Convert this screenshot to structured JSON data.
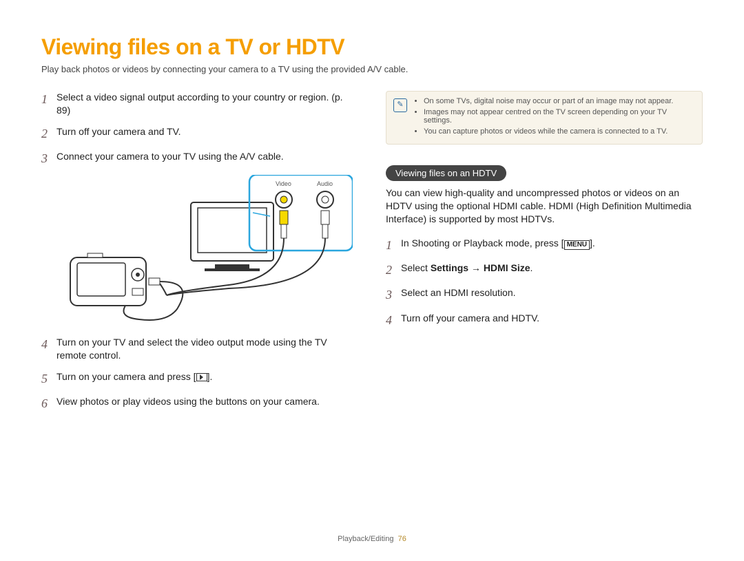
{
  "title": "Viewing files on a TV or HDTV",
  "subtitle": "Play back photos or videos by connecting your camera to a TV using the provided A/V cable.",
  "left_steps": [
    "Select a video signal output according to your country or region. (p. 89)",
    "Turn off your camera and TV.",
    "Connect your camera to your TV using the A/V cable.",
    "Turn on your TV and select the video output mode using the TV remote control.",
    "Turn on your camera and press [",
    "View photos or play videos using the buttons on your camera."
  ],
  "step5_suffix": "].",
  "diagram_labels": {
    "video": "Video",
    "audio": "Audio"
  },
  "notes": [
    "On some TVs, digital noise may occur or part of an image may not appear.",
    "Images may not appear centred on the TV screen depending on your TV settings.",
    "You can capture photos or videos while the camera is connected to a TV."
  ],
  "note_icon": "✎",
  "section2_title": "Viewing files on an HDTV",
  "section2_body": "You can view high-quality and uncompressed photos or videos on an HDTV using the optional HDMI cable. HDMI (High Definition Multimedia Interface) is supported by most HDTVs.",
  "right_steps": {
    "s1_a": "In Shooting or Playback mode, press [",
    "s1_menu": "MENU",
    "s1_b": "].",
    "s2_a": "Select ",
    "s2_bold": "Settings → HDMI Size",
    "s2_b": ".",
    "s3": "Select an HDMI resolution.",
    "s4": "Turn off your camera and HDTV."
  },
  "footer": {
    "section": "Playback/Editing",
    "page": "76"
  }
}
